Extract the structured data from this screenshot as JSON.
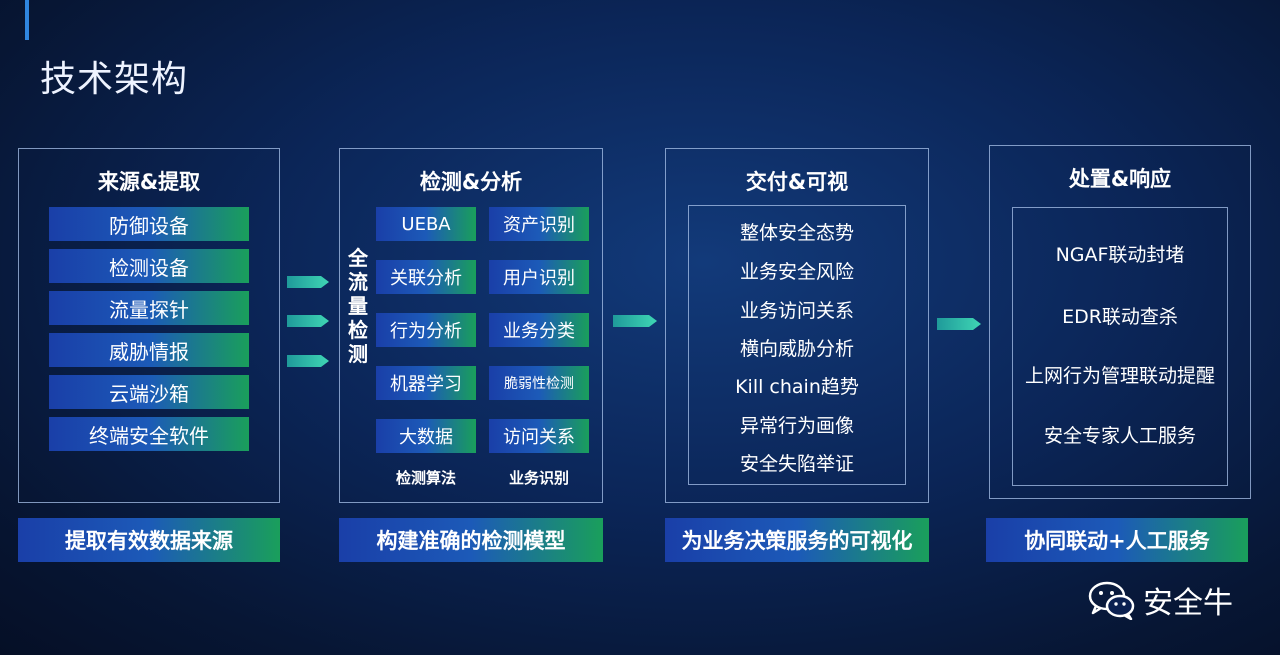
{
  "page": {
    "title": "技术架构"
  },
  "sections": [
    {
      "title": "来源&提取",
      "items": [
        "防御设备",
        "检测设备",
        "流量探针",
        "威胁情报",
        "云端沙箱",
        "终端安全软件"
      ],
      "caption": "提取有效数据来源"
    },
    {
      "title": "检测&分析",
      "side_label": "全流量检测",
      "left_items": [
        "UEBA",
        "关联分析",
        "行为分析",
        "机器学习",
        "大数据"
      ],
      "right_items": [
        "资产识别",
        "用户识别",
        "业务分类",
        "脆弱性检测",
        "访问关系"
      ],
      "left_label": "检测算法",
      "right_label": "业务识别",
      "caption": "构建准确的检测模型"
    },
    {
      "title": "交付&可视",
      "items": [
        "整体安全态势",
        "业务安全风险",
        "业务访问关系",
        "横向威胁分析",
        "Kill chain趋势",
        "异常行为画像",
        "安全失陷举证"
      ],
      "caption": "为业务决策服务的可视化"
    },
    {
      "title": "处置&响应",
      "items": [
        "NGAF联动封堵",
        "EDR联动查杀",
        "上网行为管理联动提醒",
        "安全专家人工服务"
      ],
      "caption": "协同联动+人工服务"
    }
  ],
  "brand": {
    "name": "安全牛",
    "icon": "wechat-icon"
  },
  "colors": {
    "box_start": "#1a3fa8",
    "box_end": "#1a9f5b",
    "background": "#0b2557",
    "accent": "#2f86e0"
  }
}
